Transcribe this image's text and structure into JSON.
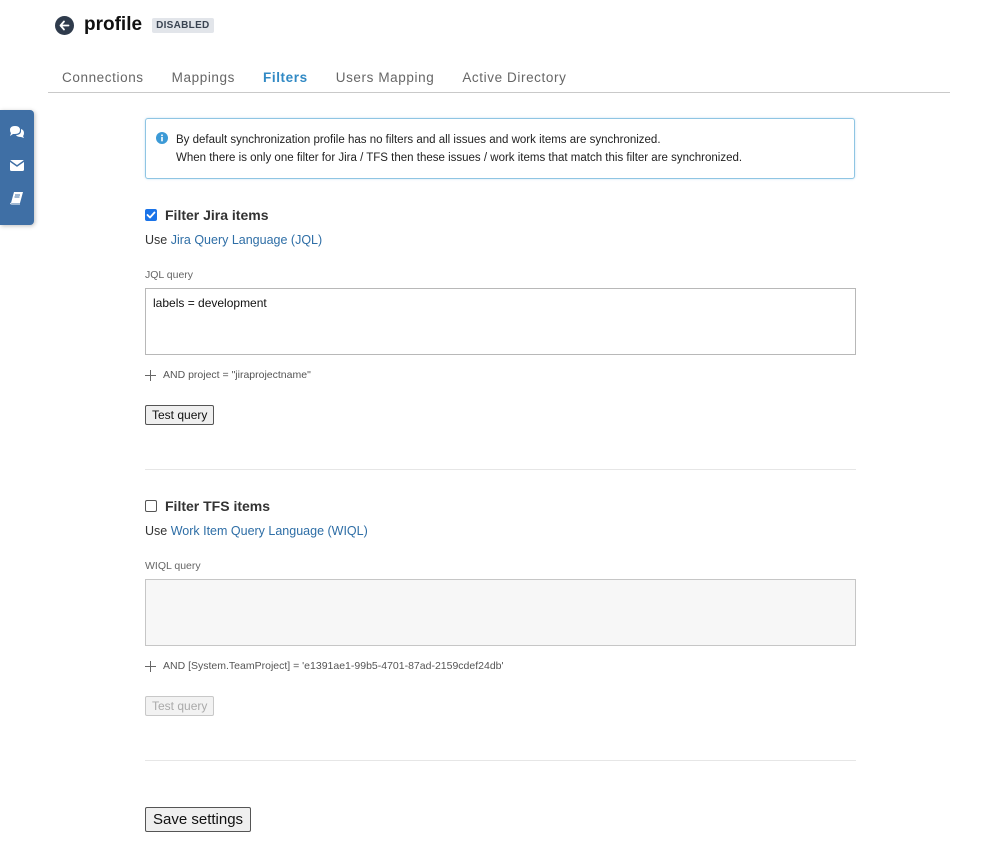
{
  "header": {
    "back_icon": "arrow-left-circle-icon",
    "title": "profile",
    "badge": "DISABLED"
  },
  "tabs": [
    {
      "label": "Connections",
      "active": false
    },
    {
      "label": "Mappings",
      "active": false
    },
    {
      "label": "Filters",
      "active": true
    },
    {
      "label": "Users Mapping",
      "active": false
    },
    {
      "label": "Active Directory",
      "active": false
    }
  ],
  "side_toolbar": {
    "icons": [
      "comments-icon",
      "envelope-icon",
      "book-icon"
    ],
    "color": "#3f6fa5"
  },
  "info": {
    "line1": "By default synchronization profile has no filters and all issues and work items are synchronized.",
    "line2": "When there is only one filter for Jira / TFS then these issues / work items that match this filter are synchronized."
  },
  "jira": {
    "checked": true,
    "label": "Filter Jira items",
    "use_prefix": "Use ",
    "link": "Jira Query Language (JQL)",
    "field_label": "JQL query",
    "query_value": "labels = development",
    "and_clause": "AND project = \"jiraprojectname\"",
    "test_button": "Test query"
  },
  "tfs": {
    "checked": false,
    "label": "Filter TFS items",
    "use_prefix": "Use ",
    "link": "Work Item Query Language (WIQL)",
    "field_label": "WIQL query",
    "query_value": "",
    "and_clause": "AND [System.TeamProject] = 'e1391ae1-99b5-4701-87ad-2159cdef24db'",
    "test_button": "Test query",
    "test_disabled": true
  },
  "save_button": "Save settings",
  "colors": {
    "accent": "#3089c4",
    "link": "#2e6ea6",
    "checkbox": "#1a73e8",
    "info_border": "#8fc5e3"
  }
}
